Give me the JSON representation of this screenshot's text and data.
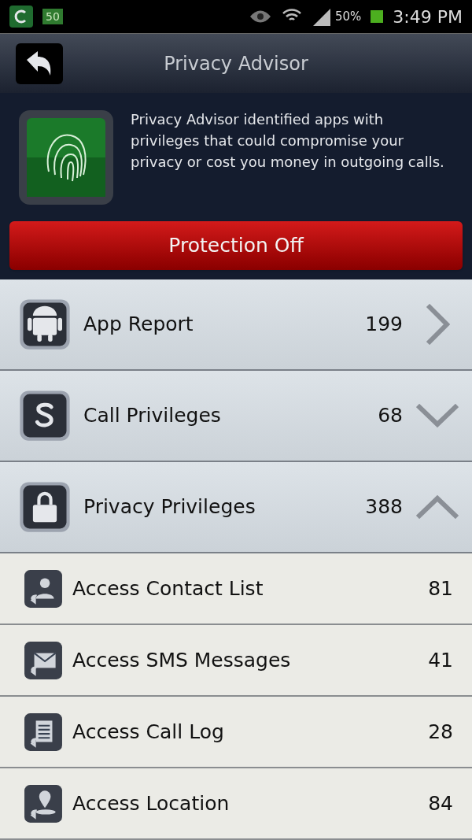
{
  "status_bar": {
    "badge": "50",
    "battery": "50%",
    "time": "3:49 PM"
  },
  "header": {
    "title": "Privacy Advisor"
  },
  "intro": {
    "text": "Privacy Advisor identified apps with privileges that could compromise your privacy or cost you money in outgoing calls.",
    "button": "Protection Off"
  },
  "categories": [
    {
      "label": "App Report",
      "count": "199",
      "kind": "link"
    },
    {
      "label": "Call Privileges",
      "count": "68",
      "kind": "group",
      "expanded": false
    },
    {
      "label": "Privacy Privileges",
      "count": "388",
      "kind": "group",
      "expanded": true
    }
  ],
  "privileges": [
    {
      "label": "Access Contact List",
      "count": "81"
    },
    {
      "label": "Access SMS Messages",
      "count": "41"
    },
    {
      "label": "Access Call Log",
      "count": "28"
    },
    {
      "label": "Access Location",
      "count": "84"
    }
  ]
}
